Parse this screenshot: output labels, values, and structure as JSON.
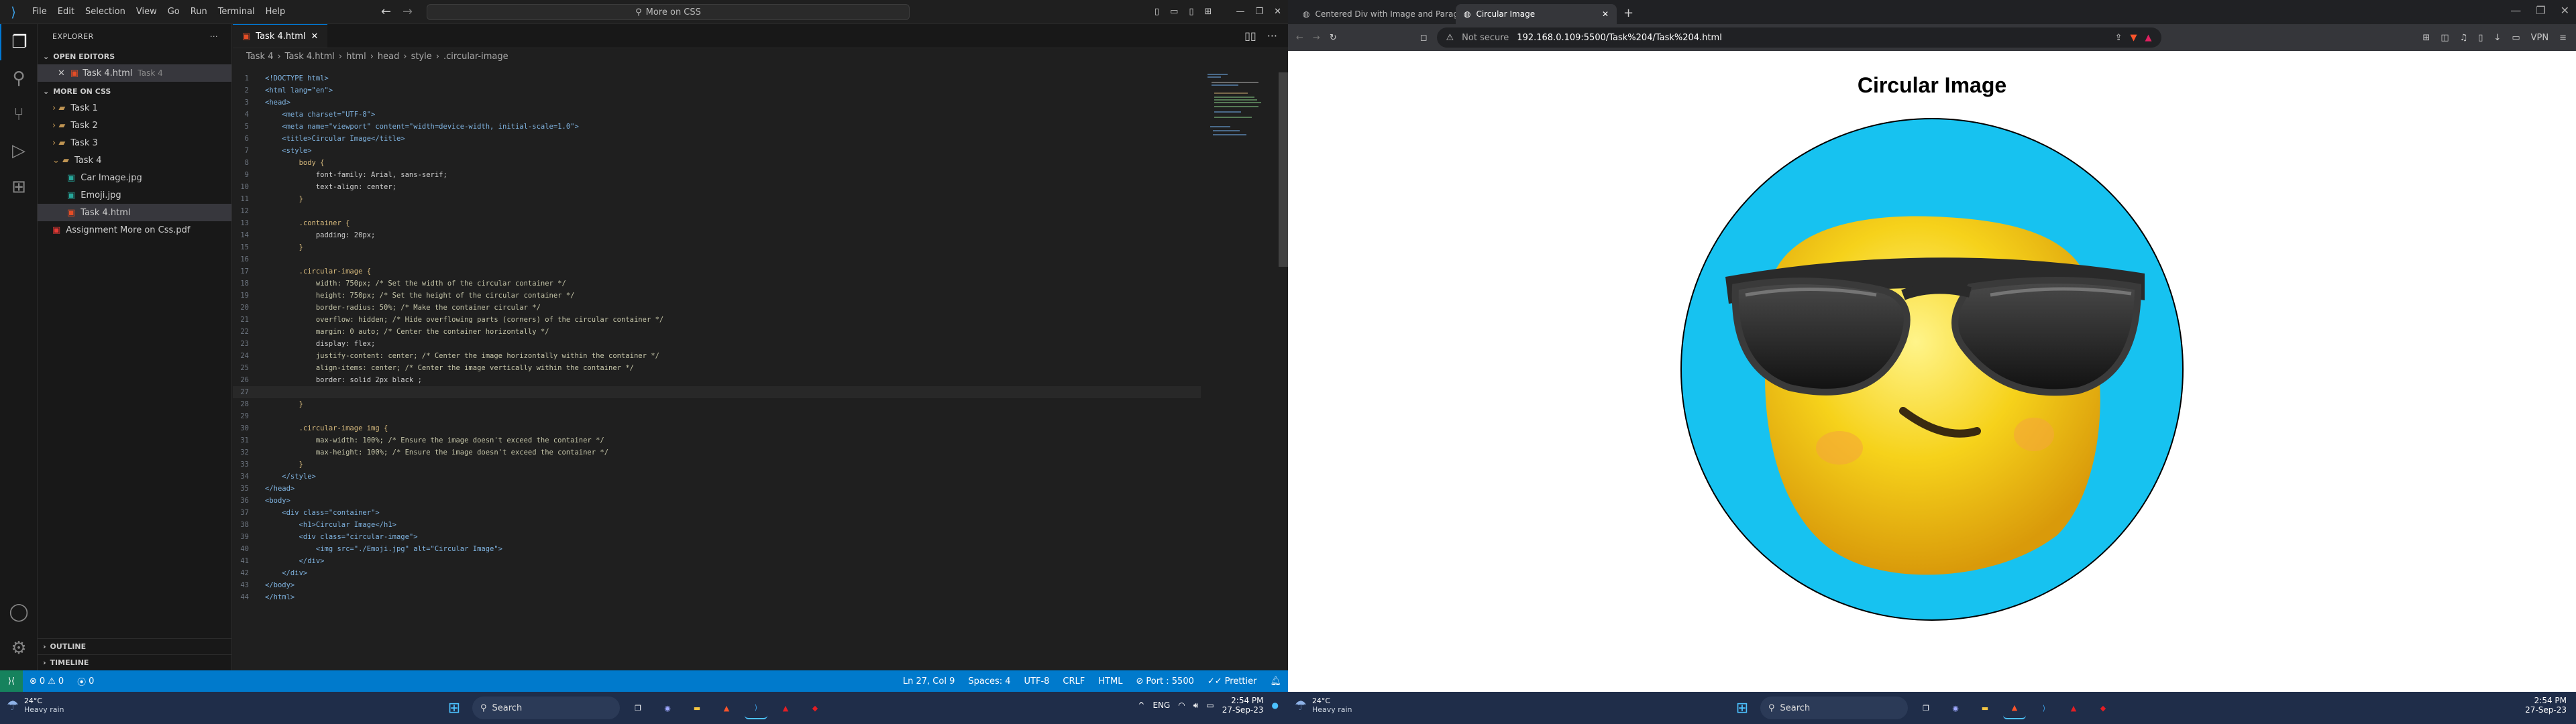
{
  "vscode": {
    "menu": [
      "File",
      "Edit",
      "Selection",
      "View",
      "Go",
      "Run",
      "Terminal",
      "Help"
    ],
    "search_text": "More on CSS",
    "explorer_title": "EXPLORER",
    "open_editors_label": "OPEN EDITORS",
    "open_editor_file": "Task 4.html",
    "open_editor_folder": "Task 4",
    "project_label": "MORE ON CSS",
    "tree": [
      {
        "label": "Task 1",
        "type": "folder"
      },
      {
        "label": "Task 2",
        "type": "folder"
      },
      {
        "label": "Task 3",
        "type": "folder"
      },
      {
        "label": "Task 4",
        "type": "folder-open"
      },
      {
        "label": "Car Image.jpg",
        "type": "image"
      },
      {
        "label": "Emoji.jpg",
        "type": "image"
      },
      {
        "label": "Task 4.html",
        "type": "html"
      },
      {
        "label": "Assignment More on Css.pdf",
        "type": "pdf"
      }
    ],
    "outline_label": "OUTLINE",
    "timeline_label": "TIMELINE",
    "tab_label": "Task 4.html",
    "breadcrumb": [
      "Task 4",
      "Task 4.html",
      "html",
      "head",
      "style",
      ".circular-image"
    ],
    "code": [
      "<!DOCTYPE html>",
      "<html lang=\"en\">",
      "<head>",
      "    <meta charset=\"UTF-8\">",
      "    <meta name=\"viewport\" content=\"width=device-width, initial-scale=1.0\">",
      "    <title>Circular Image</title>",
      "    <style>",
      "        body {",
      "            font-family: Arial, sans-serif;",
      "            text-align: center;",
      "        }",
      "",
      "        .container {",
      "            padding: 20px;",
      "        }",
      "",
      "        .circular-image {",
      "            width: 750px; /* Set the width of the circular container */",
      "            height: 750px; /* Set the height of the circular container */",
      "            border-radius: 50%; /* Make the container circular */",
      "            overflow: hidden; /* Hide overflowing parts (corners) of the circular container */",
      "            margin: 0 auto; /* Center the container horizontally */",
      "            display: flex;",
      "            justify-content: center; /* Center the image horizontally within the container */",
      "            align-items: center; /* Center the image vertically within the container */",
      "            border: solid 2px black ;",
      "",
      "        }",
      "",
      "        .circular-image img {",
      "            max-width: 100%; /* Ensure the image doesn't exceed the container */",
      "            max-height: 100%; /* Ensure the image doesn't exceed the container */",
      "        }",
      "    </style>",
      "</head>",
      "<body>",
      "    <div class=\"container\">",
      "        <h1>Circular Image</h1>",
      "        <div class=\"circular-image\">",
      "            <img src=\"./Emoji.jpg\" alt=\"Circular Image\">",
      "        </div>",
      "    </div>",
      "</body>",
      "</html>"
    ],
    "status": {
      "errors": "0",
      "warnings": "0",
      "ports": "0",
      "position": "Ln 27, Col 9",
      "spaces": "Spaces: 4",
      "encoding": "UTF-8",
      "eol": "CRLF",
      "language": "HTML",
      "port": "Port : 5500",
      "prettier": "Prettier"
    }
  },
  "browser": {
    "tabs": [
      "Centered Div with Image and Paragra",
      "Circular Image"
    ],
    "not_secure": "Not secure",
    "url": "192.168.0.109:5500/Task%204/Task%204.html",
    "vpn": "VPN",
    "page_title": "Circular Image",
    "circle_color": "#17c2f0"
  },
  "taskbar": {
    "temp": "24°C",
    "weather": "Heavy rain",
    "search": "Search",
    "lang": "ENG",
    "time": "2:54 PM",
    "date": "27-Sep-23"
  }
}
